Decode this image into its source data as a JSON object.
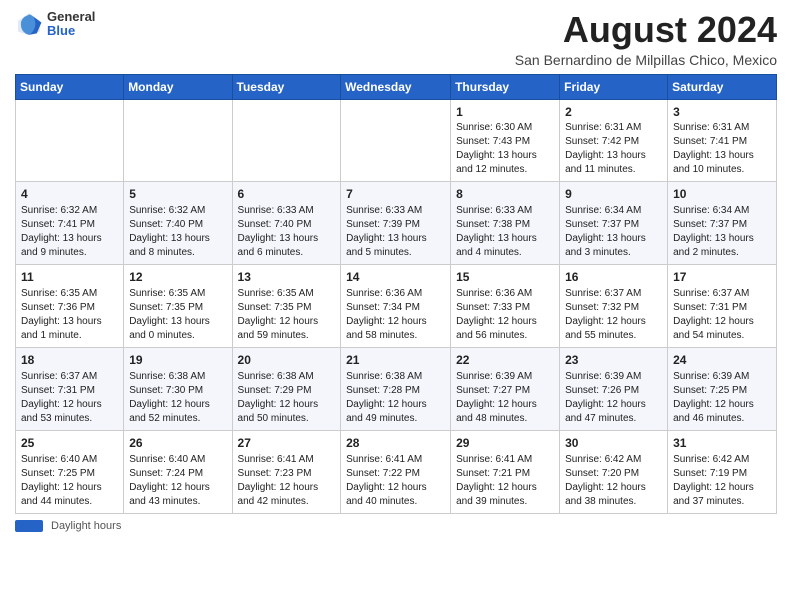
{
  "header": {
    "logo_general": "General",
    "logo_blue": "Blue",
    "title": "August 2024",
    "subtitle": "San Bernardino de Milpillas Chico, Mexico"
  },
  "weekdays": [
    "Sunday",
    "Monday",
    "Tuesday",
    "Wednesday",
    "Thursday",
    "Friday",
    "Saturday"
  ],
  "weeks": [
    [
      {
        "day": "",
        "info": ""
      },
      {
        "day": "",
        "info": ""
      },
      {
        "day": "",
        "info": ""
      },
      {
        "day": "",
        "info": ""
      },
      {
        "day": "1",
        "info": "Sunrise: 6:30 AM\nSunset: 7:43 PM\nDaylight: 13 hours and 12 minutes."
      },
      {
        "day": "2",
        "info": "Sunrise: 6:31 AM\nSunset: 7:42 PM\nDaylight: 13 hours and 11 minutes."
      },
      {
        "day": "3",
        "info": "Sunrise: 6:31 AM\nSunset: 7:41 PM\nDaylight: 13 hours and 10 minutes."
      }
    ],
    [
      {
        "day": "4",
        "info": "Sunrise: 6:32 AM\nSunset: 7:41 PM\nDaylight: 13 hours and 9 minutes."
      },
      {
        "day": "5",
        "info": "Sunrise: 6:32 AM\nSunset: 7:40 PM\nDaylight: 13 hours and 8 minutes."
      },
      {
        "day": "6",
        "info": "Sunrise: 6:33 AM\nSunset: 7:40 PM\nDaylight: 13 hours and 6 minutes."
      },
      {
        "day": "7",
        "info": "Sunrise: 6:33 AM\nSunset: 7:39 PM\nDaylight: 13 hours and 5 minutes."
      },
      {
        "day": "8",
        "info": "Sunrise: 6:33 AM\nSunset: 7:38 PM\nDaylight: 13 hours and 4 minutes."
      },
      {
        "day": "9",
        "info": "Sunrise: 6:34 AM\nSunset: 7:37 PM\nDaylight: 13 hours and 3 minutes."
      },
      {
        "day": "10",
        "info": "Sunrise: 6:34 AM\nSunset: 7:37 PM\nDaylight: 13 hours and 2 minutes."
      }
    ],
    [
      {
        "day": "11",
        "info": "Sunrise: 6:35 AM\nSunset: 7:36 PM\nDaylight: 13 hours and 1 minute."
      },
      {
        "day": "12",
        "info": "Sunrise: 6:35 AM\nSunset: 7:35 PM\nDaylight: 13 hours and 0 minutes."
      },
      {
        "day": "13",
        "info": "Sunrise: 6:35 AM\nSunset: 7:35 PM\nDaylight: 12 hours and 59 minutes."
      },
      {
        "day": "14",
        "info": "Sunrise: 6:36 AM\nSunset: 7:34 PM\nDaylight: 12 hours and 58 minutes."
      },
      {
        "day": "15",
        "info": "Sunrise: 6:36 AM\nSunset: 7:33 PM\nDaylight: 12 hours and 56 minutes."
      },
      {
        "day": "16",
        "info": "Sunrise: 6:37 AM\nSunset: 7:32 PM\nDaylight: 12 hours and 55 minutes."
      },
      {
        "day": "17",
        "info": "Sunrise: 6:37 AM\nSunset: 7:31 PM\nDaylight: 12 hours and 54 minutes."
      }
    ],
    [
      {
        "day": "18",
        "info": "Sunrise: 6:37 AM\nSunset: 7:31 PM\nDaylight: 12 hours and 53 minutes."
      },
      {
        "day": "19",
        "info": "Sunrise: 6:38 AM\nSunset: 7:30 PM\nDaylight: 12 hours and 52 minutes."
      },
      {
        "day": "20",
        "info": "Sunrise: 6:38 AM\nSunset: 7:29 PM\nDaylight: 12 hours and 50 minutes."
      },
      {
        "day": "21",
        "info": "Sunrise: 6:38 AM\nSunset: 7:28 PM\nDaylight: 12 hours and 49 minutes."
      },
      {
        "day": "22",
        "info": "Sunrise: 6:39 AM\nSunset: 7:27 PM\nDaylight: 12 hours and 48 minutes."
      },
      {
        "day": "23",
        "info": "Sunrise: 6:39 AM\nSunset: 7:26 PM\nDaylight: 12 hours and 47 minutes."
      },
      {
        "day": "24",
        "info": "Sunrise: 6:39 AM\nSunset: 7:25 PM\nDaylight: 12 hours and 46 minutes."
      }
    ],
    [
      {
        "day": "25",
        "info": "Sunrise: 6:40 AM\nSunset: 7:25 PM\nDaylight: 12 hours and 44 minutes."
      },
      {
        "day": "26",
        "info": "Sunrise: 6:40 AM\nSunset: 7:24 PM\nDaylight: 12 hours and 43 minutes."
      },
      {
        "day": "27",
        "info": "Sunrise: 6:41 AM\nSunset: 7:23 PM\nDaylight: 12 hours and 42 minutes."
      },
      {
        "day": "28",
        "info": "Sunrise: 6:41 AM\nSunset: 7:22 PM\nDaylight: 12 hours and 40 minutes."
      },
      {
        "day": "29",
        "info": "Sunrise: 6:41 AM\nSunset: 7:21 PM\nDaylight: 12 hours and 39 minutes."
      },
      {
        "day": "30",
        "info": "Sunrise: 6:42 AM\nSunset: 7:20 PM\nDaylight: 12 hours and 38 minutes."
      },
      {
        "day": "31",
        "info": "Sunrise: 6:42 AM\nSunset: 7:19 PM\nDaylight: 12 hours and 37 minutes."
      }
    ]
  ],
  "footer": {
    "daylight_label": "Daylight hours"
  }
}
